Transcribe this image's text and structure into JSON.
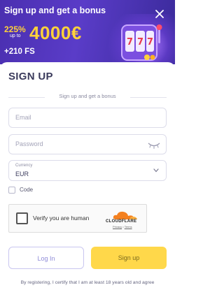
{
  "banner": {
    "title": "Sign up and get a bonus",
    "percent": "225%",
    "up_to": "up to",
    "amount": "4000€",
    "free_spins": "+210 FS"
  },
  "form": {
    "title": "SIGN UP",
    "subtitle": "Sign up and get a bonus",
    "email_placeholder": "Email",
    "password_placeholder": "Password",
    "currency_label": "Currency",
    "currency_value": "EUR",
    "code_label": "Code"
  },
  "captcha": {
    "label": "Verify you are human",
    "brand": "CLOUDFLARE",
    "privacy": "Privacy",
    "terms": "Terms"
  },
  "buttons": {
    "login": "Log In",
    "signup": "Sign up"
  },
  "legal": {
    "text": "By registering, I certify that I am at least 18 years old and agree"
  },
  "colors": {
    "banner_bg": "#4a2fb0",
    "accent_yellow": "#ffd84a",
    "bonus_yellow": "#ffd23a"
  }
}
